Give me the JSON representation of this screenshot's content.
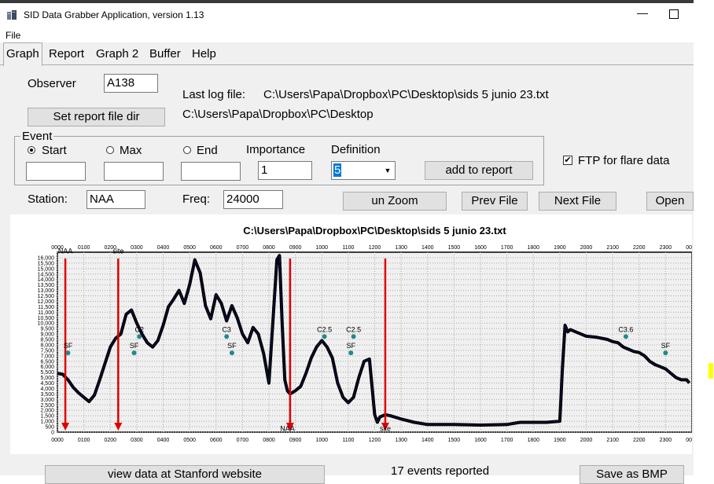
{
  "window": {
    "title": "SID Data Grabber Application, version 1.13",
    "minimize": "—"
  },
  "menu": {
    "file": "File"
  },
  "tabs": [
    "Graph",
    "Report",
    "Graph 2",
    "Buffer",
    "Help"
  ],
  "observer": {
    "label": "Observer",
    "value": "A138"
  },
  "log": {
    "label": "Last log file:",
    "path": "C:\\Users\\Papa\\Dropbox\\PC\\Desktop\\sids 5 junio 23.txt",
    "dir": "C:\\Users\\Papa\\Dropbox\\PC\\Desktop"
  },
  "buttons": {
    "set_report": "Set report file dir",
    "add_report": "add to report",
    "unzoom": "un Zoom",
    "prev": "Prev File",
    "next": "Next File",
    "open": "Open",
    "view_stanford": "view data at Stanford website",
    "save_bmp": "Save as BMP"
  },
  "event": {
    "legend": "Event",
    "start": "Start",
    "max": "Max",
    "end": "End",
    "importance_label": "Importance",
    "importance_value": "1",
    "definition_label": "Definition",
    "definition_value": "5",
    "selected": "Start"
  },
  "ftp": {
    "label": "FTP for flare data",
    "checked": true,
    "check": "✔"
  },
  "station": {
    "label": "Station:",
    "value": "NAA"
  },
  "freq": {
    "label": "Freq:",
    "value": "24000"
  },
  "status": {
    "events": "17 events reported"
  },
  "chart_data": {
    "type": "line",
    "title": "C:\\Users\\Papa\\Dropbox\\PC\\Desktop\\sids 5 junio 23.txt",
    "xlim": [
      0,
      2400
    ],
    "ylim": [
      0,
      16500
    ],
    "x_ticks": [
      "0000",
      "0100",
      "0200",
      "0300",
      "0400",
      "0500",
      "0600",
      "0700",
      "0800",
      "0900",
      "1000",
      "1100",
      "1200",
      "1300",
      "1400",
      "1500",
      "1600",
      "1700",
      "1800",
      "1900",
      "2000",
      "2100",
      "2200",
      "2300",
      "0000"
    ],
    "y_ticks": [
      0,
      500,
      1000,
      1500,
      2000,
      2500,
      3000,
      3500,
      4000,
      4500,
      5000,
      5500,
      6000,
      6500,
      7000,
      7500,
      8000,
      8500,
      9000,
      9500,
      10000,
      10500,
      11000,
      11500,
      12000,
      12500,
      13000,
      13500,
      14000,
      14500,
      15000,
      15500,
      16000
    ],
    "series": [
      {
        "x": [
          0,
          20,
          40,
          60,
          80,
          100,
          120,
          140,
          160,
          180,
          200,
          220,
          240,
          260,
          280,
          300,
          320,
          340,
          360,
          380,
          400,
          420,
          440,
          460,
          480,
          500,
          520,
          540,
          560,
          580,
          600,
          620,
          640,
          660,
          680,
          700,
          720,
          740,
          760,
          780,
          800,
          820,
          830,
          840,
          850,
          860,
          870,
          880,
          900,
          920,
          940,
          960,
          980,
          1000,
          1020,
          1040,
          1060,
          1080,
          1100,
          1120,
          1140,
          1160,
          1180,
          1200,
          1210,
          1220,
          1240,
          1260,
          1300,
          1350,
          1400,
          1500,
          1600,
          1700,
          1750,
          1800,
          1850,
          1900,
          1910,
          1920,
          1930,
          1940,
          1960,
          2000,
          2040,
          2080,
          2100,
          2120,
          2140,
          2160,
          2180,
          2200,
          2220,
          2240,
          2260,
          2280,
          2300,
          2320,
          2340,
          2360,
          2380,
          2390
        ],
        "values": [
          5400,
          5300,
          4800,
          4100,
          3600,
          3200,
          2800,
          3400,
          4800,
          6300,
          7800,
          8600,
          9000,
          10800,
          11200,
          10000,
          9000,
          8200,
          7800,
          8400,
          9800,
          11500,
          12200,
          13000,
          11800,
          13500,
          15800,
          14600,
          11600,
          10400,
          12600,
          11800,
          10200,
          11600,
          10500,
          9000,
          8200,
          9600,
          9000,
          7200,
          4500,
          12000,
          15800,
          16200,
          10000,
          4800,
          3800,
          3500,
          3800,
          4200,
          5400,
          6800,
          7800,
          8400,
          7800,
          6800,
          4500,
          3200,
          2700,
          3200,
          5000,
          6500,
          6700,
          1600,
          900,
          1400,
          1600,
          1500,
          1200,
          900,
          700,
          700,
          650,
          700,
          900,
          900,
          900,
          1000,
          5800,
          9800,
          9200,
          9400,
          9200,
          8800,
          8700,
          8500,
          8300,
          8200,
          7800,
          7600,
          7400,
          7300,
          7000,
          6500,
          6200,
          6000,
          5800,
          5400,
          5000,
          4800,
          4800,
          4500
        ]
      }
    ],
    "annotations": [
      {
        "text": "NAA",
        "x": 30,
        "y": 16400
      },
      {
        "text": "site",
        "x": 230,
        "y": 16400
      },
      {
        "text": "SF",
        "x": 40,
        "y": 7700
      },
      {
        "text": "SF",
        "x": 290,
        "y": 7700
      },
      {
        "text": "C2",
        "x": 310,
        "y": 9200
      },
      {
        "text": "SF",
        "x": 660,
        "y": 7700
      },
      {
        "text": "C3",
        "x": 640,
        "y": 9200
      },
      {
        "text": "C2.5",
        "x": 1010,
        "y": 9200
      },
      {
        "text": "C2.5",
        "x": 1120,
        "y": 9200
      },
      {
        "text": "SF",
        "x": 1110,
        "y": 7700
      },
      {
        "text": "C3.6",
        "x": 2150,
        "y": 9200
      },
      {
        "text": "SF",
        "x": 2300,
        "y": 7700
      },
      {
        "text": "NAA",
        "x": 870,
        "y": 100
      },
      {
        "text": "site",
        "x": 1240,
        "y": 100
      }
    ],
    "red_arrows_x": [
      30,
      230,
      880,
      1240
    ],
    "grid": true
  }
}
